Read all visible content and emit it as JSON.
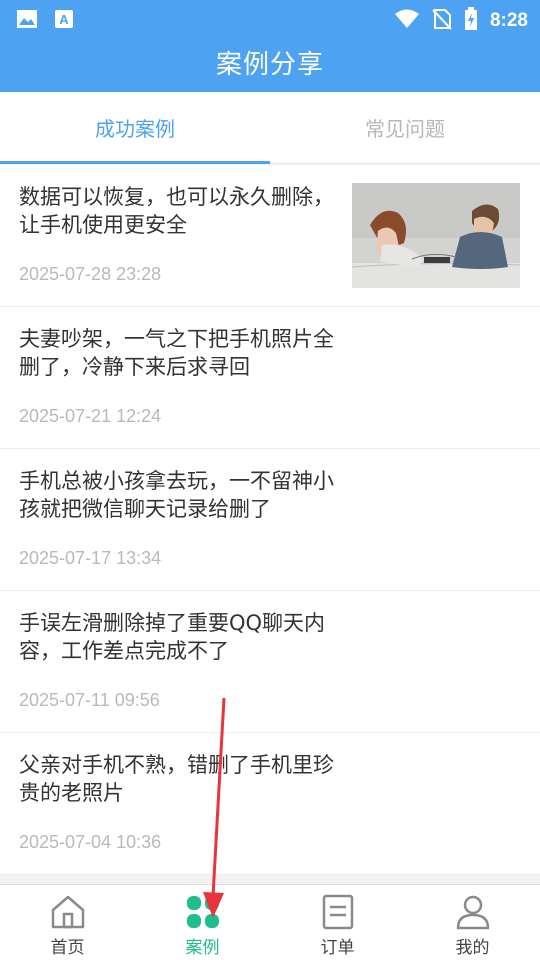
{
  "status_bar": {
    "time": "8:28",
    "left_icons": [
      "image-icon",
      "font-a-icon"
    ],
    "right_icons": [
      "wifi-icon",
      "no-sim-icon",
      "battery-charging-icon"
    ]
  },
  "header": {
    "title": "案例分享"
  },
  "tabs": [
    {
      "label": "成功案例",
      "active": true
    },
    {
      "label": "常见问题",
      "active": false
    }
  ],
  "cases": [
    {
      "title": "数据可以恢复，也可以永久删除，让手机使用更安全",
      "date": "2025-07-28 23:28",
      "has_image": true
    },
    {
      "title": "夫妻吵架，一气之下把手机照片全删了，冷静下来后求寻回",
      "date": "2025-07-21 12:24",
      "has_image": false
    },
    {
      "title": "手机总被小孩拿去玩，一不留神小孩就把微信聊天记录给删了",
      "date": "2025-07-17 13:34",
      "has_image": false
    },
    {
      "title": "手误左滑删除掉了重要QQ聊天内容，工作差点完成不了",
      "date": "2025-07-11 09:56",
      "has_image": false
    },
    {
      "title": "父亲对手机不熟，错删了手机里珍贵的老照片",
      "date": "2025-07-04 10:36",
      "has_image": false
    }
  ],
  "bottom_nav": [
    {
      "label": "首页",
      "icon": "home-icon",
      "active": false
    },
    {
      "label": "案例",
      "icon": "case-grid-icon",
      "active": true
    },
    {
      "label": "订单",
      "icon": "order-icon",
      "active": false
    },
    {
      "label": "我的",
      "icon": "profile-icon",
      "active": false
    }
  ],
  "colors": {
    "primary": "#4da3f1",
    "active_nav": "#1fbe8c",
    "annotation_arrow": "#e8343d"
  }
}
